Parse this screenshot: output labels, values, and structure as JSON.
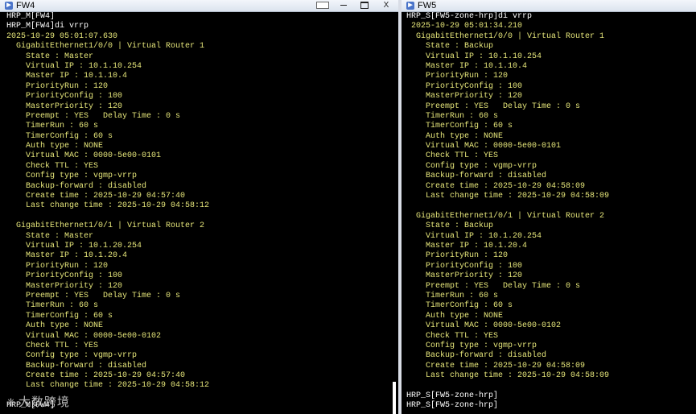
{
  "left_window": {
    "title": "FW4",
    "lines": [
      {
        "text": "HRP_M[FW4]",
        "kind": "cmd"
      },
      {
        "text": "HRP_M[FW4]di vrrp",
        "kind": "cmd"
      },
      {
        "text": "2025-10-29 05:01:07.630",
        "kind": "out"
      },
      {
        "text": "  GigabitEthernet1/0/0 | Virtual Router 1",
        "kind": "out"
      },
      {
        "text": "    State : Master",
        "kind": "out"
      },
      {
        "text": "    Virtual IP : 10.1.10.254",
        "kind": "out"
      },
      {
        "text": "    Master IP : 10.1.10.4",
        "kind": "out"
      },
      {
        "text": "    PriorityRun : 120",
        "kind": "out"
      },
      {
        "text": "    PriorityConfig : 100",
        "kind": "out"
      },
      {
        "text": "    MasterPriority : 120",
        "kind": "out"
      },
      {
        "text": "    Preempt : YES   Delay Time : 0 s",
        "kind": "out"
      },
      {
        "text": "    TimerRun : 60 s",
        "kind": "out"
      },
      {
        "text": "    TimerConfig : 60 s",
        "kind": "out"
      },
      {
        "text": "    Auth type : NONE",
        "kind": "out"
      },
      {
        "text": "    Virtual MAC : 0000-5e00-0101",
        "kind": "out"
      },
      {
        "text": "    Check TTL : YES",
        "kind": "out"
      },
      {
        "text": "    Config type : vgmp-vrrp",
        "kind": "out"
      },
      {
        "text": "    Backup-forward : disabled",
        "kind": "out"
      },
      {
        "text": "    Create time : 2025-10-29 04:57:40",
        "kind": "out"
      },
      {
        "text": "    Last change time : 2025-10-29 04:58:12",
        "kind": "out"
      },
      {
        "text": "",
        "kind": "out"
      },
      {
        "text": "  GigabitEthernet1/0/1 | Virtual Router 2",
        "kind": "out"
      },
      {
        "text": "    State : Master",
        "kind": "out"
      },
      {
        "text": "    Virtual IP : 10.1.20.254",
        "kind": "out"
      },
      {
        "text": "    Master IP : 10.1.20.4",
        "kind": "out"
      },
      {
        "text": "    PriorityRun : 120",
        "kind": "out"
      },
      {
        "text": "    PriorityConfig : 100",
        "kind": "out"
      },
      {
        "text": "    MasterPriority : 120",
        "kind": "out"
      },
      {
        "text": "    Preempt : YES   Delay Time : 0 s",
        "kind": "out"
      },
      {
        "text": "    TimerRun : 60 s",
        "kind": "out"
      },
      {
        "text": "    TimerConfig : 60 s",
        "kind": "out"
      },
      {
        "text": "    Auth type : NONE",
        "kind": "out"
      },
      {
        "text": "    Virtual MAC : 0000-5e00-0102",
        "kind": "out"
      },
      {
        "text": "    Check TTL : YES",
        "kind": "out"
      },
      {
        "text": "    Config type : vgmp-vrrp",
        "kind": "out"
      },
      {
        "text": "    Backup-forward : disabled",
        "kind": "out"
      },
      {
        "text": "    Create time : 2025-10-29 04:57:40",
        "kind": "out"
      },
      {
        "text": "    Last change time : 2025-10-29 04:58:12",
        "kind": "out"
      },
      {
        "text": "",
        "kind": "out"
      },
      {
        "text": "HRP_M[FW4]",
        "kind": "cmd"
      }
    ]
  },
  "right_window": {
    "title": "FW5",
    "lines": [
      {
        "text": "HRP_S[FW5-zone-hrp]di vrrp",
        "kind": "cmd"
      },
      {
        "text": " 2025-10-29 05:01:34.210",
        "kind": "out"
      },
      {
        "text": "  GigabitEthernet1/0/0 | Virtual Router 1",
        "kind": "out"
      },
      {
        "text": "    State : Backup",
        "kind": "out"
      },
      {
        "text": "    Virtual IP : 10.1.10.254",
        "kind": "out"
      },
      {
        "text": "    Master IP : 10.1.10.4",
        "kind": "out"
      },
      {
        "text": "    PriorityRun : 120",
        "kind": "out"
      },
      {
        "text": "    PriorityConfig : 100",
        "kind": "out"
      },
      {
        "text": "    MasterPriority : 120",
        "kind": "out"
      },
      {
        "text": "    Preempt : YES   Delay Time : 0 s",
        "kind": "out"
      },
      {
        "text": "    TimerRun : 60 s",
        "kind": "out"
      },
      {
        "text": "    TimerConfig : 60 s",
        "kind": "out"
      },
      {
        "text": "    Auth type : NONE",
        "kind": "out"
      },
      {
        "text": "    Virtual MAC : 0000-5e00-0101",
        "kind": "out"
      },
      {
        "text": "    Check TTL : YES",
        "kind": "out"
      },
      {
        "text": "    Config type : vgmp-vrrp",
        "kind": "out"
      },
      {
        "text": "    Backup-forward : disabled",
        "kind": "out"
      },
      {
        "text": "    Create time : 2025-10-29 04:58:09",
        "kind": "out"
      },
      {
        "text": "    Last change time : 2025-10-29 04:58:09",
        "kind": "out"
      },
      {
        "text": "",
        "kind": "out"
      },
      {
        "text": "  GigabitEthernet1/0/1 | Virtual Router 2",
        "kind": "out"
      },
      {
        "text": "    State : Backup",
        "kind": "out"
      },
      {
        "text": "    Virtual IP : 10.1.20.254",
        "kind": "out"
      },
      {
        "text": "    Master IP : 10.1.20.4",
        "kind": "out"
      },
      {
        "text": "    PriorityRun : 120",
        "kind": "out"
      },
      {
        "text": "    PriorityConfig : 100",
        "kind": "out"
      },
      {
        "text": "    MasterPriority : 120",
        "kind": "out"
      },
      {
        "text": "    Preempt : YES   Delay Time : 0 s",
        "kind": "out"
      },
      {
        "text": "    TimerRun : 60 s",
        "kind": "out"
      },
      {
        "text": "    TimerConfig : 60 s",
        "kind": "out"
      },
      {
        "text": "    Auth type : NONE",
        "kind": "out"
      },
      {
        "text": "    Virtual MAC : 0000-5e00-0102",
        "kind": "out"
      },
      {
        "text": "    Check TTL : YES",
        "kind": "out"
      },
      {
        "text": "    Config type : vgmp-vrrp",
        "kind": "out"
      },
      {
        "text": "    Backup-forward : disabled",
        "kind": "out"
      },
      {
        "text": "    Create time : 2025-10-29 04:58:09",
        "kind": "out"
      },
      {
        "text": "    Last change time : 2025-10-29 04:58:09",
        "kind": "out"
      },
      {
        "text": "",
        "kind": "out"
      },
      {
        "text": "HRP_S[FW5-zone-hrp]",
        "kind": "cmd"
      },
      {
        "text": "HRP_S[FW5-zone-hrp]",
        "kind": "cmd"
      }
    ]
  },
  "window_controls": {
    "restore_icon": "restore-icon",
    "minimize_label": "–",
    "maximize_icon": "maximize-icon",
    "close_label": "X"
  },
  "watermark": {
    "logo": "❈",
    "text": "大数跨境"
  },
  "colors": {
    "terminal_bg": "#000000",
    "output_text": "#e6e67a",
    "prompt_text": "#ffffff",
    "titlebar": "#dbe3ee"
  }
}
